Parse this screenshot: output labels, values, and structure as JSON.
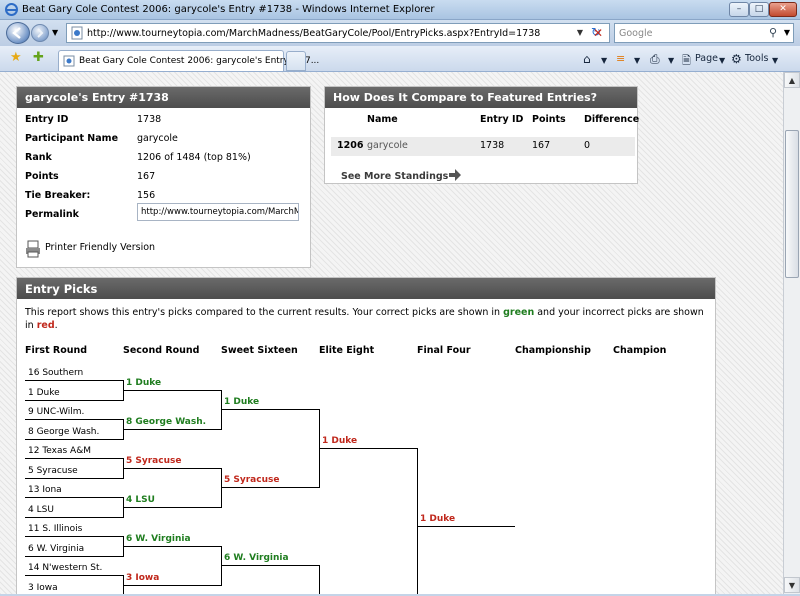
{
  "window": {
    "title": "Beat Gary Cole Contest 2006: garycole's Entry #1738 - Windows Internet Explorer",
    "url": "http://www.tourneytopia.com/MarchMadness/BeatGaryCole/Pool/EntryPicks.aspx?EntryId=1738",
    "search_placeholder": "Google",
    "tab_label": "Beat Gary Cole Contest 2006: garycole's Entry #17...",
    "cmd_page": "Page",
    "cmd_tools": "Tools"
  },
  "entry": {
    "header": "garycole's Entry #1738",
    "fields": [
      {
        "label": "Entry ID",
        "value": "1738"
      },
      {
        "label": "Participant Name",
        "value": "garycole"
      },
      {
        "label": "Rank",
        "value": "1206 of 1484 (top 81%)"
      },
      {
        "label": "Points",
        "value": "167"
      },
      {
        "label": "Tie Breaker:",
        "value": "156"
      }
    ],
    "permalink_label": "Permalink",
    "permalink_value": "http://www.tourneytopia.com/MarchM",
    "printer_link": "Printer Friendly Version"
  },
  "compare": {
    "header": "How Does It Compare to Featured Entries?",
    "columns": [
      "Name",
      "Entry ID",
      "Points",
      "Difference"
    ],
    "row": {
      "rank": "1206",
      "name": "garycole",
      "entry_id": "1738",
      "points": "167",
      "difference": "0"
    },
    "more_link": "See More Standings"
  },
  "picks": {
    "header": "Entry Picks",
    "intro_pre": "This report shows this entry's picks compared to the current results. Your correct picks are shown in ",
    "intro_green": "green",
    "intro_mid": " and your incorrect picks are shown in ",
    "intro_red": "red",
    "intro_post": ".",
    "rounds": [
      "First Round",
      "Second Round",
      "Sweet Sixteen",
      "Elite Eight",
      "Final Four",
      "Championship",
      "Champion"
    ],
    "first_round": [
      "16 Southern",
      "1 Duke",
      "9 UNC-Wilm.",
      "8 George Wash.",
      "12 Texas A&M",
      "5 Syracuse",
      "13 Iona",
      "4 LSU",
      "11 S. Illinois",
      "6 W. Virginia",
      "14 N'western St.",
      "3 Iowa"
    ],
    "second_round": [
      {
        "team": "1 Duke",
        "status": "correct"
      },
      {
        "team": "8 George Wash.",
        "status": "correct"
      },
      {
        "team": "5 Syracuse",
        "status": "incorrect"
      },
      {
        "team": "4 LSU",
        "status": "correct"
      },
      {
        "team": "6 W. Virginia",
        "status": "correct"
      },
      {
        "team": "3 Iowa",
        "status": "incorrect"
      }
    ],
    "sweet_sixteen": [
      {
        "team": "1 Duke",
        "status": "correct"
      },
      {
        "team": "5 Syracuse",
        "status": "incorrect"
      },
      {
        "team": "6 W. Virginia",
        "status": "correct"
      }
    ],
    "elite_eight": [
      {
        "team": "1 Duke",
        "status": "incorrect"
      }
    ],
    "final_four": [
      {
        "team": "1 Duke",
        "status": "incorrect"
      }
    ]
  },
  "colors": {
    "correct": "#1f7d1f",
    "incorrect": "#c0281c",
    "panel_header": "#555555"
  }
}
